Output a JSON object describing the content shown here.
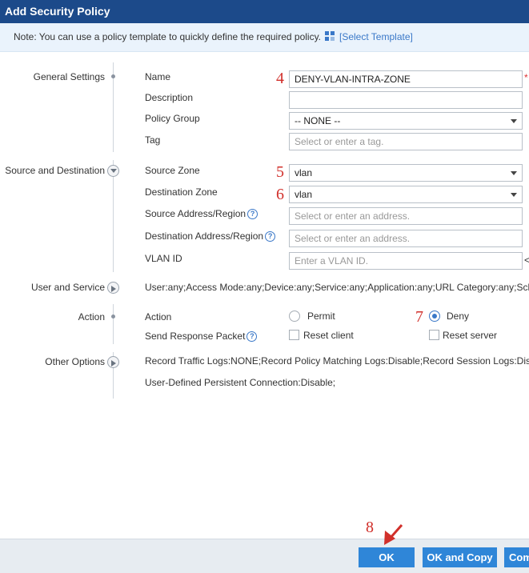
{
  "title": "Add Security Policy",
  "note": {
    "text": "Note: You can use a policy template to quickly define the required policy.",
    "link": "[Select Template]"
  },
  "sections": {
    "general": "General Settings",
    "source_dest": "Source and Destination",
    "user_service": "User and Service",
    "action": "Action",
    "other": "Other Options"
  },
  "fields": {
    "name": {
      "label": "Name",
      "value": "DENY-VLAN-INTRA-ZONE",
      "required_mark": "*"
    },
    "description": {
      "label": "Description",
      "value": ""
    },
    "policy_group": {
      "label": "Policy Group",
      "value": "-- NONE --"
    },
    "tag": {
      "label": "Tag",
      "placeholder": "Select or enter a tag."
    },
    "source_zone": {
      "label": "Source Zone",
      "value": "vlan"
    },
    "destination_zone": {
      "label": "Destination Zone",
      "value": "vlan"
    },
    "source_address": {
      "label": "Source Address/Region",
      "placeholder": "Select or enter an address."
    },
    "destination_address": {
      "label": "Destination Address/Region",
      "placeholder": "Select or enter an address."
    },
    "vlan_id": {
      "label": "VLAN ID",
      "placeholder": "Enter a VLAN ID.",
      "trailing": "<"
    }
  },
  "user_service_summary": "User:any;Access Mode:any;Device:any;Service:any;Application:any;URL Category:any;Sch",
  "action": {
    "label": "Action",
    "permit": "Permit",
    "deny": "Deny",
    "selected": "Deny",
    "send_response_label": "Send Response Packet",
    "reset_client": "Reset client",
    "reset_server": "Reset server"
  },
  "other_options": {
    "line1": "Record Traffic Logs:NONE;Record Policy Matching Logs:Disable;Record Session Logs:Dis",
    "line2": "User-Defined Persistent Connection:Disable;"
  },
  "step_markers": [
    "4",
    "5",
    "6",
    "7",
    "8"
  ],
  "buttons": {
    "ok": "OK",
    "ok_copy": "OK and Copy",
    "third": "Com"
  },
  "colors": {
    "header": "#1c4a8a",
    "accent": "#2f86d8",
    "annotation": "#d1302b"
  }
}
